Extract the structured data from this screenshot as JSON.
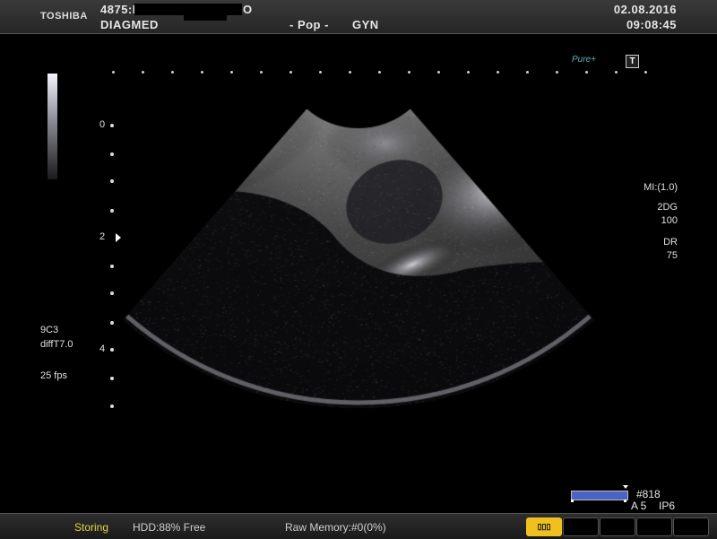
{
  "header": {
    "brand": "TOSHIBA",
    "patient_id": "4875:L",
    "patient_id_tail": "O",
    "institution": "DIAGMED",
    "preset": "- Pop -",
    "exam": "GYN",
    "date": "02.08.2016",
    "time": "09:08:45"
  },
  "top_right": {
    "logo": "Pure+",
    "t_badge": "T"
  },
  "depth_scale": {
    "labels": [
      "0",
      "2",
      "4"
    ]
  },
  "right_panel": {
    "mi": "MI:(1.0)",
    "mode": "2DG",
    "gain": "100",
    "dr_label": "DR",
    "dr_value": "75"
  },
  "left_panel": {
    "probe": "9C3",
    "harmonic": "diffT7.0",
    "frame_rate": "25 fps"
  },
  "cine": {
    "frame": "#818",
    "av": "A 5",
    "ip": "IP6"
  },
  "footer": {
    "storing": "Storing",
    "hdd": "HDD:88% Free",
    "raw_memory": "Raw Memory:#0(0%)",
    "active_button_icon": "film-strip-icon"
  },
  "colors": {
    "storing": "#e2d54a",
    "cine_bar": "#4a63c4",
    "active_button": "#f0c020"
  }
}
